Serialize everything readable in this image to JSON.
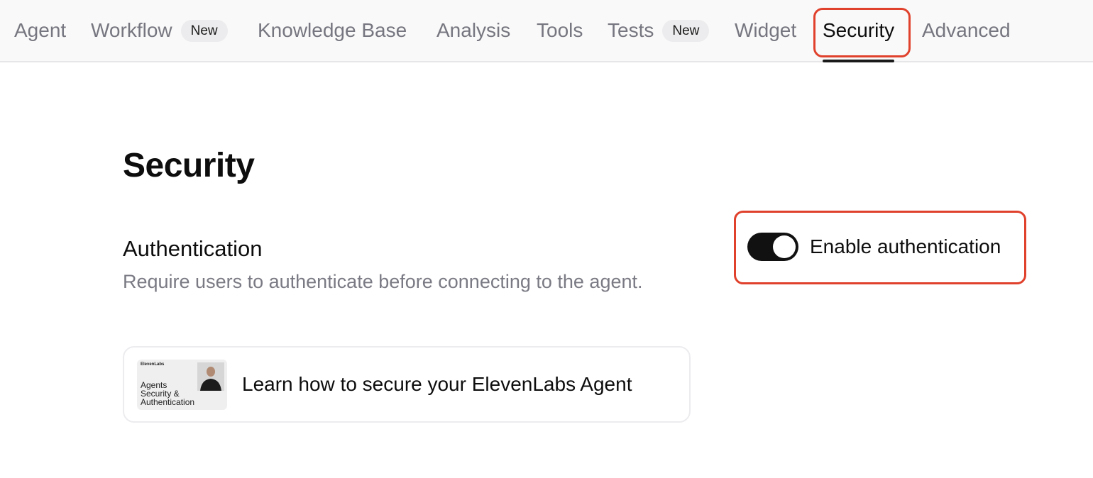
{
  "tabs": [
    {
      "label": "Agent",
      "badge": ""
    },
    {
      "label": "Workflow",
      "badge": "New"
    },
    {
      "label": "Knowledge Base",
      "badge": ""
    },
    {
      "label": "Analysis",
      "badge": ""
    },
    {
      "label": "Tools",
      "badge": ""
    },
    {
      "label": "Tests",
      "badge": "New"
    },
    {
      "label": "Widget",
      "badge": ""
    },
    {
      "label": "Security",
      "badge": "",
      "active": true
    },
    {
      "label": "Advanced",
      "badge": ""
    }
  ],
  "page": {
    "title": "Security"
  },
  "authentication": {
    "title": "Authentication",
    "description": "Require users to authenticate before connecting to the agent.",
    "toggle_label": "Enable authentication",
    "toggle_on": true
  },
  "learn_card": {
    "text": "Learn how to secure your ElevenLabs Agent",
    "thumbnail": {
      "brand": "ElevenLabs",
      "caption_lines": [
        "Agents",
        "Security &",
        "Authentication"
      ]
    }
  },
  "colors": {
    "highlight": "#e0412c",
    "toggle_on": "#111111",
    "muted_text": "#7a7a84"
  }
}
